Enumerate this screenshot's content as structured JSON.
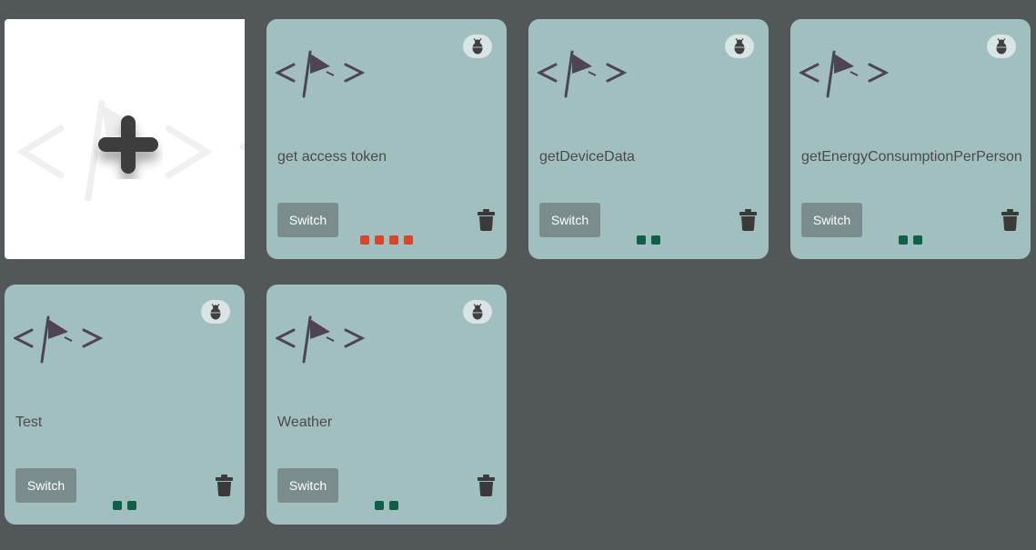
{
  "add_tile": {
    "icon": "plus-icon",
    "watermark_icon": "code-flag-icon"
  },
  "cards": [
    {
      "name": "get access token",
      "switch_label": "Switch",
      "dots": [
        "#d9472b",
        "#d9472b",
        "#d9472b",
        "#d9472b"
      ]
    },
    {
      "name": "getDeviceData",
      "switch_label": "Switch",
      "dots": [
        "#0d5f46",
        "#0d5f46"
      ]
    },
    {
      "name": "getEnergyConsumptionPerPerson",
      "switch_label": "Switch",
      "dots": [
        "#0d5f46",
        "#0d5f46"
      ]
    },
    {
      "name": "Test",
      "switch_label": "Switch",
      "dots": [
        "#0d5f46",
        "#0d5f46"
      ]
    },
    {
      "name": "Weather",
      "switch_label": "Switch",
      "dots": [
        "#0d5f46",
        "#0d5f46"
      ]
    }
  ],
  "icons": {
    "logo": "code-flag-icon",
    "debug": "bug-icon",
    "delete": "trash-icon"
  },
  "colors": {
    "background": "#525859",
    "card": "#a2bfbf",
    "switch_button": "#7b8c8c",
    "error_dot": "#d9472b",
    "ok_dot": "#0d5f46"
  }
}
